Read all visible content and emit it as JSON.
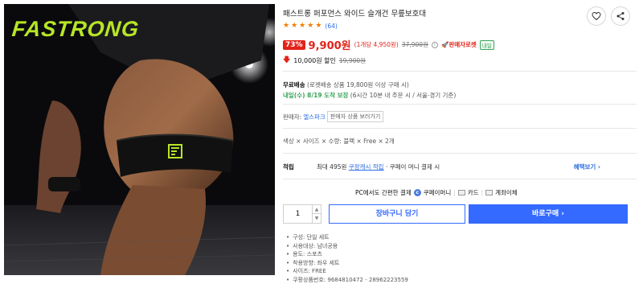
{
  "product_image": {
    "brand_text": "FASTRONG",
    "band_brand_text": "FASTRONG"
  },
  "header": {
    "title": "패스트롱 퍼포먼스 와이드 슬개건 무릎보호대"
  },
  "rating": {
    "stars": 5,
    "count": "(64)"
  },
  "price": {
    "discount": "73%",
    "sale_price": "9,900원",
    "unit_price": "(1개당 4,950원)",
    "original_price": "37,900원",
    "rocket_label": "판매자로켓",
    "tomorrow_label": "내일"
  },
  "coupon": {
    "amount": "10,000원 할인",
    "original": "19,900원"
  },
  "shipping": {
    "free_label": "무료배송",
    "free_condition": "(로켓배송 상품 19,800원 이상 구매 시)",
    "eta_date": "내일(수) 8/19 도착 보장",
    "eta_condition": "(6시간 10분 내 주문 시 / 서울⋅경기 기준)"
  },
  "seller": {
    "label": "판매자:",
    "name": "엘스파크",
    "more_button": "판매자 상품 보러가기"
  },
  "options": {
    "summary": "색상 × 사이즈 × 수량: 블랙 × Free × 2개"
  },
  "points": {
    "label": "적립",
    "prefix": "최대 495원",
    "link": "쿠팡캐시 적립",
    "suffix": " · 쿠페이 머니 결제 시",
    "benefit": "혜택보기 ›"
  },
  "payment": {
    "text": "PC에서도 간편한 결제",
    "coupay_label": "쿠페이머니",
    "card_label": "카드",
    "transfer_label": "계좌이체"
  },
  "purchase": {
    "quantity": "1",
    "cart_button": "장바구니 담기",
    "buy_button": "바로구매 ›"
  },
  "attributes": [
    "구성: 단일 세트",
    "사용대상: 남녀공용",
    "용도: 스포츠",
    "착용방향: 좌우 세트",
    "사이즈: FREE",
    "쿠팡상품번호: 9684810472 - 28962223559"
  ],
  "colors": {
    "accent_red": "#e2231a",
    "accent_blue": "#346aff",
    "brand_green": "#b7e526"
  }
}
